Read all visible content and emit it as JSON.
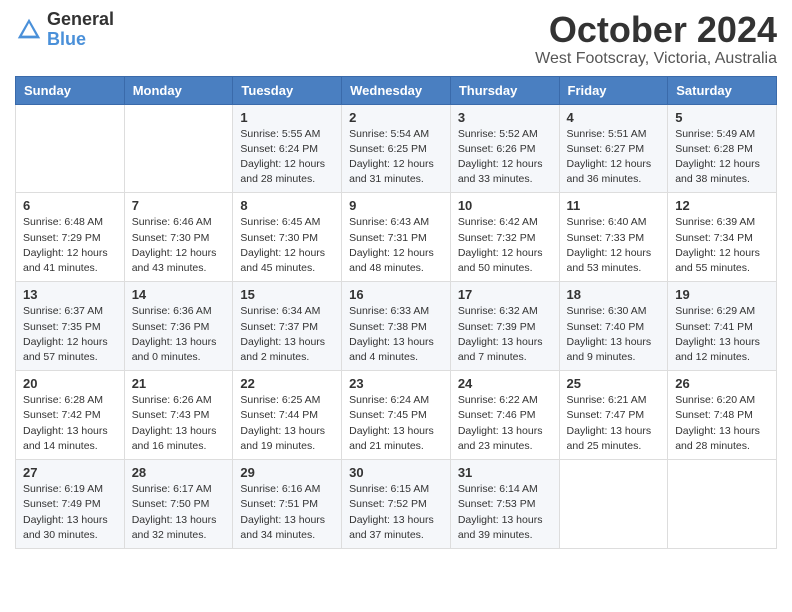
{
  "header": {
    "logo_general": "General",
    "logo_blue": "Blue",
    "month_title": "October 2024",
    "location": "West Footscray, Victoria, Australia"
  },
  "weekdays": [
    "Sunday",
    "Monday",
    "Tuesday",
    "Wednesday",
    "Thursday",
    "Friday",
    "Saturday"
  ],
  "weeks": [
    [
      {
        "day": "",
        "info": ""
      },
      {
        "day": "",
        "info": ""
      },
      {
        "day": "1",
        "info": "Sunrise: 5:55 AM\nSunset: 6:24 PM\nDaylight: 12 hours and 28 minutes."
      },
      {
        "day": "2",
        "info": "Sunrise: 5:54 AM\nSunset: 6:25 PM\nDaylight: 12 hours and 31 minutes."
      },
      {
        "day": "3",
        "info": "Sunrise: 5:52 AM\nSunset: 6:26 PM\nDaylight: 12 hours and 33 minutes."
      },
      {
        "day": "4",
        "info": "Sunrise: 5:51 AM\nSunset: 6:27 PM\nDaylight: 12 hours and 36 minutes."
      },
      {
        "day": "5",
        "info": "Sunrise: 5:49 AM\nSunset: 6:28 PM\nDaylight: 12 hours and 38 minutes."
      }
    ],
    [
      {
        "day": "6",
        "info": "Sunrise: 6:48 AM\nSunset: 7:29 PM\nDaylight: 12 hours and 41 minutes."
      },
      {
        "day": "7",
        "info": "Sunrise: 6:46 AM\nSunset: 7:30 PM\nDaylight: 12 hours and 43 minutes."
      },
      {
        "day": "8",
        "info": "Sunrise: 6:45 AM\nSunset: 7:30 PM\nDaylight: 12 hours and 45 minutes."
      },
      {
        "day": "9",
        "info": "Sunrise: 6:43 AM\nSunset: 7:31 PM\nDaylight: 12 hours and 48 minutes."
      },
      {
        "day": "10",
        "info": "Sunrise: 6:42 AM\nSunset: 7:32 PM\nDaylight: 12 hours and 50 minutes."
      },
      {
        "day": "11",
        "info": "Sunrise: 6:40 AM\nSunset: 7:33 PM\nDaylight: 12 hours and 53 minutes."
      },
      {
        "day": "12",
        "info": "Sunrise: 6:39 AM\nSunset: 7:34 PM\nDaylight: 12 hours and 55 minutes."
      }
    ],
    [
      {
        "day": "13",
        "info": "Sunrise: 6:37 AM\nSunset: 7:35 PM\nDaylight: 12 hours and 57 minutes."
      },
      {
        "day": "14",
        "info": "Sunrise: 6:36 AM\nSunset: 7:36 PM\nDaylight: 13 hours and 0 minutes."
      },
      {
        "day": "15",
        "info": "Sunrise: 6:34 AM\nSunset: 7:37 PM\nDaylight: 13 hours and 2 minutes."
      },
      {
        "day": "16",
        "info": "Sunrise: 6:33 AM\nSunset: 7:38 PM\nDaylight: 13 hours and 4 minutes."
      },
      {
        "day": "17",
        "info": "Sunrise: 6:32 AM\nSunset: 7:39 PM\nDaylight: 13 hours and 7 minutes."
      },
      {
        "day": "18",
        "info": "Sunrise: 6:30 AM\nSunset: 7:40 PM\nDaylight: 13 hours and 9 minutes."
      },
      {
        "day": "19",
        "info": "Sunrise: 6:29 AM\nSunset: 7:41 PM\nDaylight: 13 hours and 12 minutes."
      }
    ],
    [
      {
        "day": "20",
        "info": "Sunrise: 6:28 AM\nSunset: 7:42 PM\nDaylight: 13 hours and 14 minutes."
      },
      {
        "day": "21",
        "info": "Sunrise: 6:26 AM\nSunset: 7:43 PM\nDaylight: 13 hours and 16 minutes."
      },
      {
        "day": "22",
        "info": "Sunrise: 6:25 AM\nSunset: 7:44 PM\nDaylight: 13 hours and 19 minutes."
      },
      {
        "day": "23",
        "info": "Sunrise: 6:24 AM\nSunset: 7:45 PM\nDaylight: 13 hours and 21 minutes."
      },
      {
        "day": "24",
        "info": "Sunrise: 6:22 AM\nSunset: 7:46 PM\nDaylight: 13 hours and 23 minutes."
      },
      {
        "day": "25",
        "info": "Sunrise: 6:21 AM\nSunset: 7:47 PM\nDaylight: 13 hours and 25 minutes."
      },
      {
        "day": "26",
        "info": "Sunrise: 6:20 AM\nSunset: 7:48 PM\nDaylight: 13 hours and 28 minutes."
      }
    ],
    [
      {
        "day": "27",
        "info": "Sunrise: 6:19 AM\nSunset: 7:49 PM\nDaylight: 13 hours and 30 minutes."
      },
      {
        "day": "28",
        "info": "Sunrise: 6:17 AM\nSunset: 7:50 PM\nDaylight: 13 hours and 32 minutes."
      },
      {
        "day": "29",
        "info": "Sunrise: 6:16 AM\nSunset: 7:51 PM\nDaylight: 13 hours and 34 minutes."
      },
      {
        "day": "30",
        "info": "Sunrise: 6:15 AM\nSunset: 7:52 PM\nDaylight: 13 hours and 37 minutes."
      },
      {
        "day": "31",
        "info": "Sunrise: 6:14 AM\nSunset: 7:53 PM\nDaylight: 13 hours and 39 minutes."
      },
      {
        "day": "",
        "info": ""
      },
      {
        "day": "",
        "info": ""
      }
    ]
  ]
}
